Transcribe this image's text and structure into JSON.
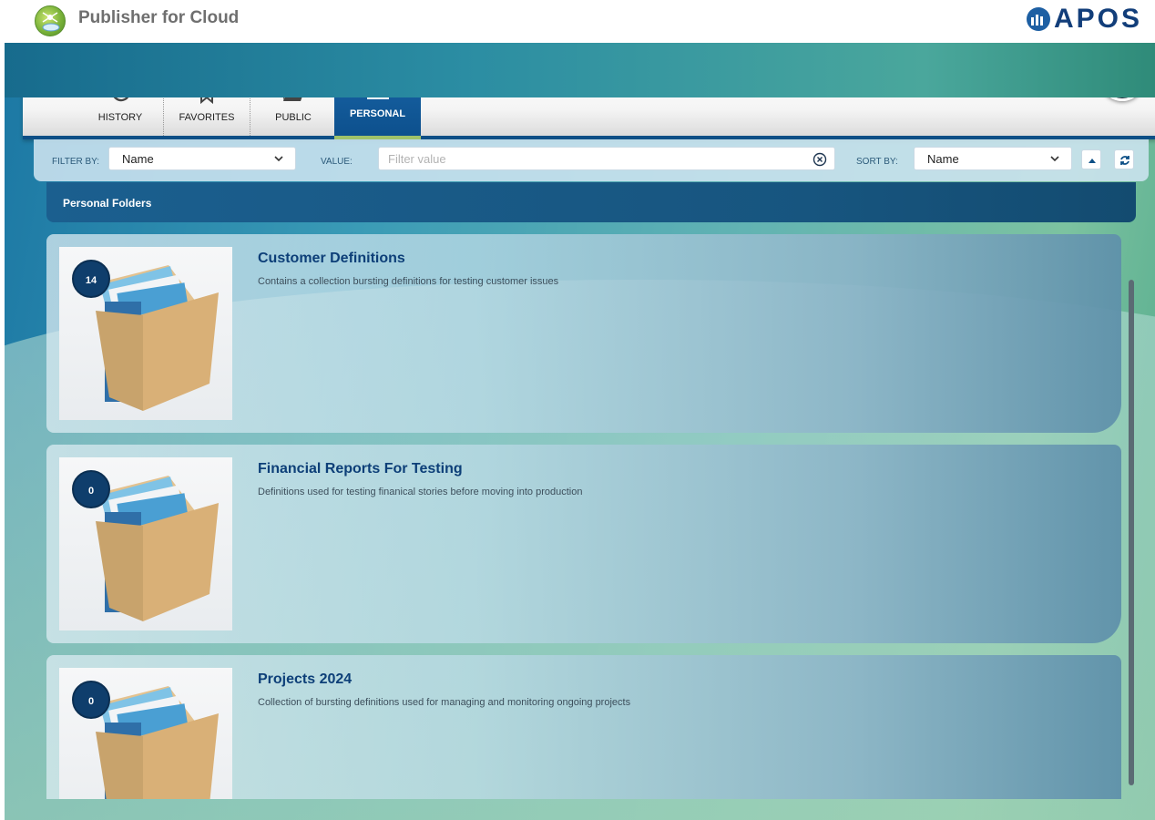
{
  "app": {
    "title": "Publisher for Cloud",
    "brand": "APOS"
  },
  "tabs": [
    {
      "label": "HISTORY",
      "icon": "history-icon"
    },
    {
      "label": "FAVORITES",
      "icon": "bookmark-icon"
    },
    {
      "label": "PUBLIC",
      "icon": "folder-open-icon"
    },
    {
      "label": "PERSONAL",
      "icon": "folder-icon",
      "active": true
    }
  ],
  "filter": {
    "filter_by_label": "FILTER BY:",
    "filter_by_value": "Name",
    "value_label": "VALUE:",
    "value_placeholder": "Filter value",
    "sort_by_label": "SORT BY:",
    "sort_by_value": "Name"
  },
  "section": {
    "title": "Personal Folders"
  },
  "folders": [
    {
      "count": "14",
      "title": "Customer Definitions",
      "description": "Contains a collection bursting definitions for testing customer issues"
    },
    {
      "count": "0",
      "title": "Financial Reports For Testing",
      "description": "Definitions used for testing finanical stories before moving into production"
    },
    {
      "count": "0",
      "title": "Projects 2024",
      "description": "Collection of bursting definitions used for managing and monitoring ongoing projects"
    }
  ],
  "colors": {
    "primary": "#0d4f86",
    "accent": "#9fc26a",
    "title": "#0d3f78"
  }
}
